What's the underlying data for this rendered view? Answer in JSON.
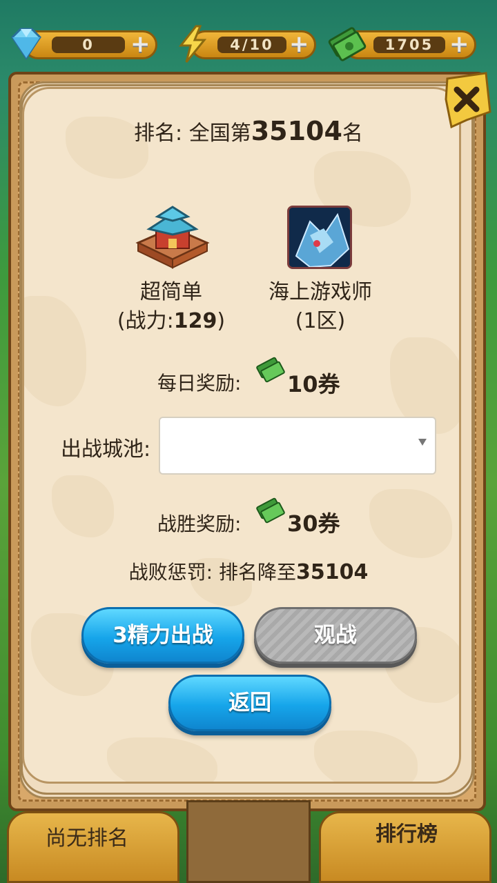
{
  "resources": {
    "gems": "0",
    "energy": "4/10",
    "cash": "1705"
  },
  "dialog": {
    "rank_prefix": "排名: 全国第",
    "rank_number": "35104",
    "rank_suffix": "名",
    "player": {
      "name": "超简单",
      "power_prefix": "(战力:",
      "power_value": "129",
      "power_suffix": ")"
    },
    "opponent": {
      "name": "海上游戏师",
      "zone": "(1区)"
    },
    "daily_reward_label": "每日奖励:",
    "daily_reward_value": "10券",
    "city_select_label": "出战城池:",
    "city_select_value": "",
    "win_reward_label": "战胜奖励:",
    "win_reward_value": "30券",
    "penalty_label": "战败惩罚: 排名降至",
    "penalty_value": "35104",
    "buttons": {
      "fight": "3精力出战",
      "watch": "观战",
      "back": "返回"
    }
  },
  "bottom": {
    "left_label": "尚无排名",
    "right_label": "排行榜"
  }
}
